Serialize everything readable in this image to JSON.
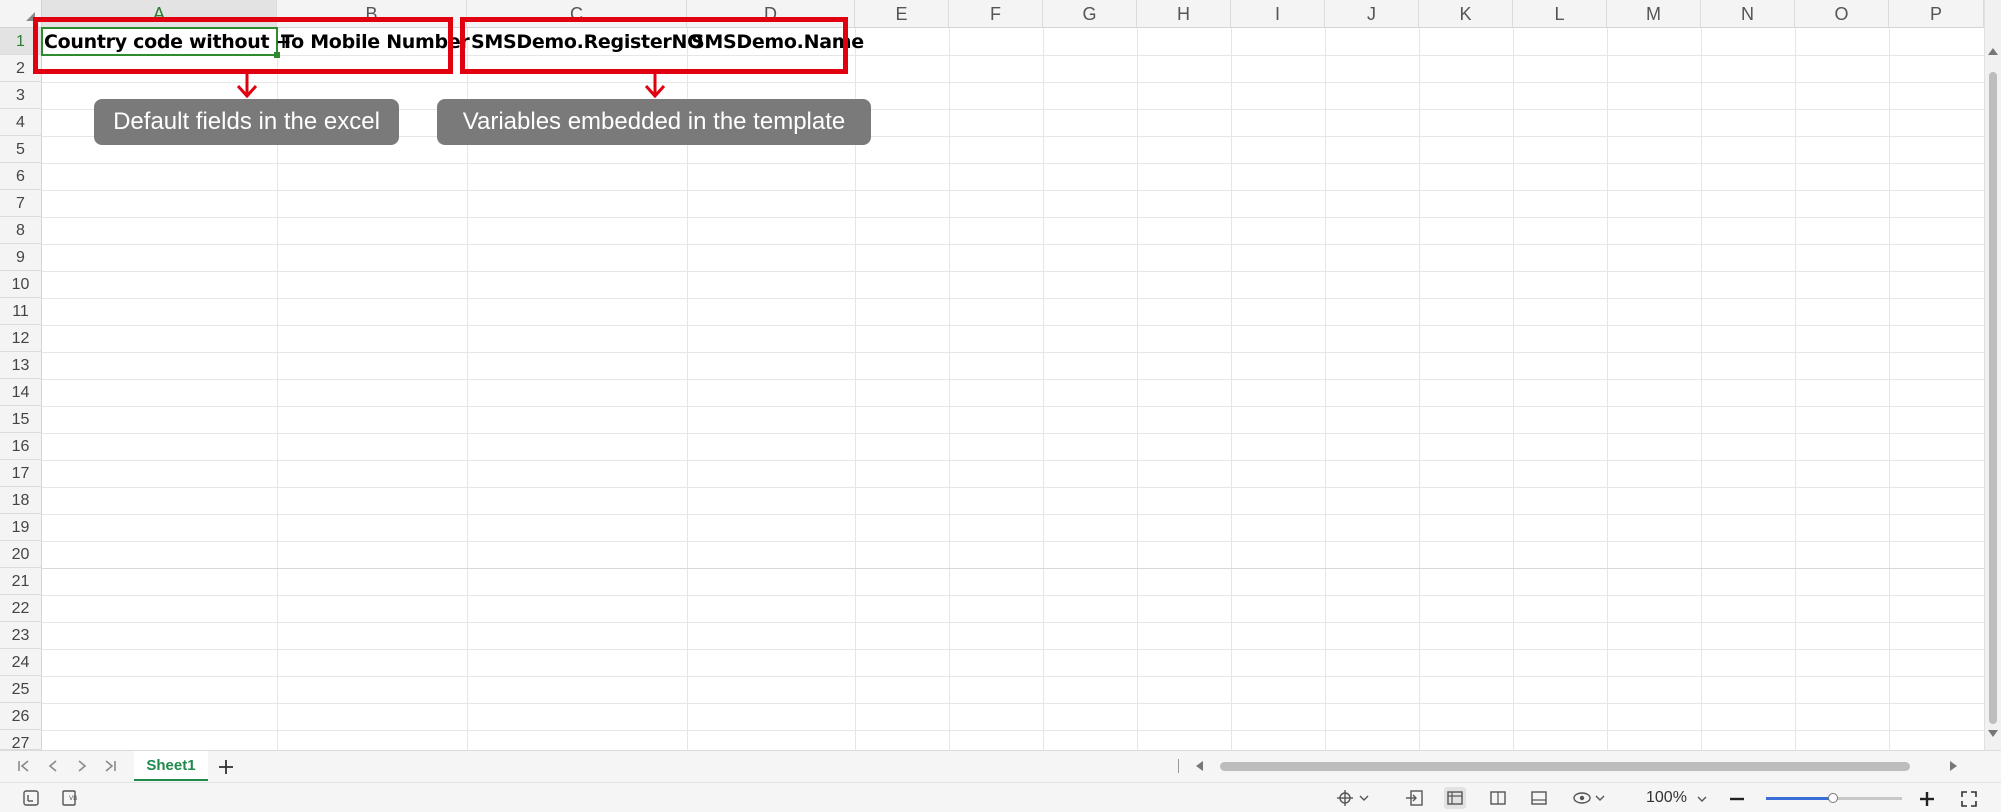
{
  "columns": [
    "A",
    "B",
    "C",
    "D",
    "E",
    "F",
    "G",
    "H",
    "I",
    "J",
    "K",
    "L",
    "M",
    "N",
    "O",
    "P"
  ],
  "rows": [
    "1",
    "2",
    "3",
    "4",
    "5",
    "6",
    "7",
    "8",
    "9",
    "10",
    "11",
    "12",
    "13",
    "14",
    "15",
    "16",
    "17",
    "18",
    "19",
    "20",
    "21",
    "22",
    "23",
    "24",
    "25",
    "26",
    "27"
  ],
  "cells": {
    "A1": "Country code without +",
    "B1": "To Mobile Number",
    "C1": "SMSDemo.RegisterNO",
    "D1": "SMSDemo.Name"
  },
  "annotations": {
    "left_callout": "Default fields in the excel",
    "right_callout": "Variables embedded in the template",
    "highlight_color": "#e0000f",
    "callout_color": "#7a7a7a"
  },
  "sheets": {
    "active": "Sheet1"
  },
  "status": {
    "zoom": "100%"
  },
  "icons": {
    "first_sheet": "first-sheet-icon",
    "prev_sheet": "prev-sheet-icon",
    "next_sheet": "next-sheet-icon",
    "last_sheet": "last-sheet-icon",
    "add_sheet": "plus-icon"
  }
}
